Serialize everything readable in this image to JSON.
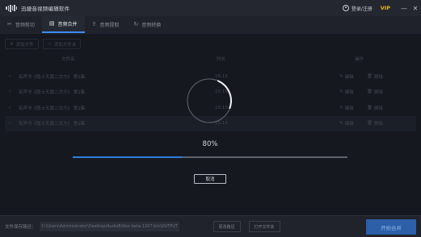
{
  "app": {
    "title": "迅捷音视频编辑软件"
  },
  "titlebar": {
    "login_label": "登录/注册",
    "vip_label": "VIP",
    "minimize_glyph": "—",
    "close_glyph": "✕"
  },
  "tabs": [
    {
      "label": "音频剪切",
      "icon": "scissors-icon",
      "active": false
    },
    {
      "label": "音频合并",
      "icon": "merge-icon",
      "active": true
    },
    {
      "label": "音频提取",
      "icon": "upload-icon",
      "active": false
    },
    {
      "label": "音频转换",
      "icon": "refresh-icon",
      "active": false
    }
  ],
  "toolbar": {
    "add_file": "添加文件",
    "add_folder": "添加文件夹"
  },
  "list": {
    "columns": {
      "name": "文件名",
      "time": "时长",
      "action": "操作"
    },
    "edit_label": "编辑",
    "delete_label": "删除",
    "rows": [
      {
        "name": "有声书《隐士天篇二次方》 第1集",
        "time": "15:15"
      },
      {
        "name": "有声书《隐士天篇二次方》 第1集",
        "time": "15:15"
      },
      {
        "name": "有声书《隐士天篇二次方》 第1集",
        "time": "15:15"
      },
      {
        "name": "有声书《隐士天篇二次方》 第1集",
        "time": "15:15"
      }
    ]
  },
  "progress": {
    "percent_label": "80%",
    "value": 0.4,
    "cancel_label": "取消"
  },
  "statusbar": {
    "save_path_label": "文件保存路径：",
    "save_path": "C:\\Users\\Administrator\\Desktop\\AudioEditor-beta-1207-bin\\OUTPUT",
    "change_path_label": "更改路径",
    "open_folder_label": "打开文件夹",
    "start_label": "开始合并"
  },
  "colors": {
    "accent": "#3b8cff",
    "vip": "#e8b618",
    "background": "#1b1e26",
    "start_button": "#2d5fa8"
  }
}
